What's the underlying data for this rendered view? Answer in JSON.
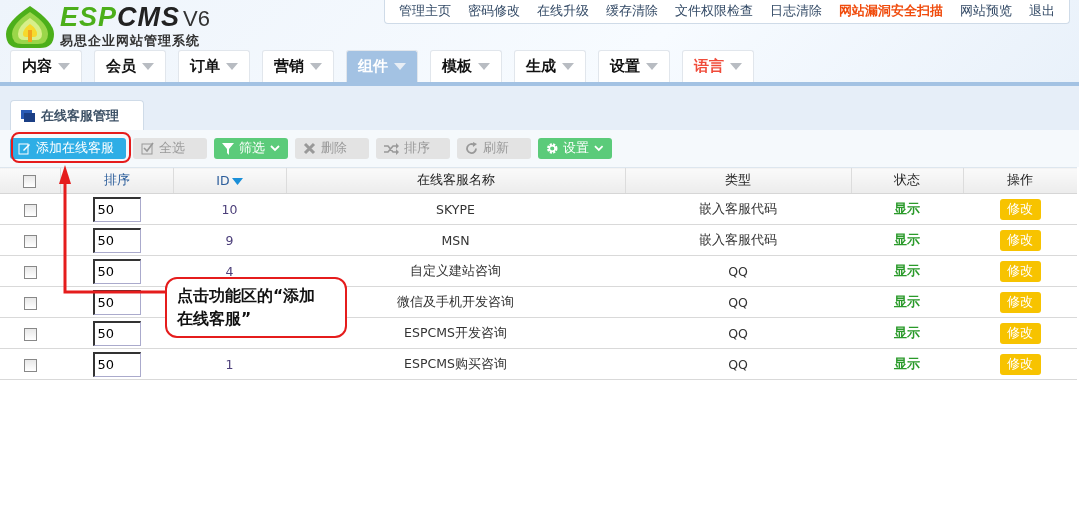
{
  "logo": {
    "brand_a": "ESP",
    "brand_b": "CMS",
    "version": "V6",
    "subtitle": "易思企业网站管理系统"
  },
  "top_links": [
    {
      "label": "管理主页",
      "highlight": false
    },
    {
      "label": "密码修改",
      "highlight": false
    },
    {
      "label": "在线升级",
      "highlight": false
    },
    {
      "label": "缓存清除",
      "highlight": false
    },
    {
      "label": "文件权限检查",
      "highlight": false
    },
    {
      "label": "日志清除",
      "highlight": false
    },
    {
      "label": "网站漏洞安全扫描",
      "highlight": true
    },
    {
      "label": "网站预览",
      "highlight": false
    },
    {
      "label": "退出",
      "highlight": false
    }
  ],
  "nav": [
    {
      "label": "内容",
      "selected": false,
      "highlight": false
    },
    {
      "label": "会员",
      "selected": false,
      "highlight": false
    },
    {
      "label": "订单",
      "selected": false,
      "highlight": false
    },
    {
      "label": "营销",
      "selected": false,
      "highlight": false
    },
    {
      "label": "组件",
      "selected": true,
      "highlight": false
    },
    {
      "label": "模板",
      "selected": false,
      "highlight": false
    },
    {
      "label": "生成",
      "selected": false,
      "highlight": false
    },
    {
      "label": "设置",
      "selected": false,
      "highlight": false
    },
    {
      "label": "语言",
      "selected": false,
      "highlight": true
    }
  ],
  "panel_tab": {
    "label": "在线客服管理"
  },
  "toolbar": [
    {
      "label": "添加在线客服",
      "kind": "primary",
      "dropdown": false
    },
    {
      "label": "全选",
      "kind": "disabled",
      "dropdown": false
    },
    {
      "label": "筛选",
      "kind": "green",
      "dropdown": true
    },
    {
      "label": "删除",
      "kind": "disabled",
      "dropdown": false
    },
    {
      "label": "排序",
      "kind": "disabled",
      "dropdown": false
    },
    {
      "label": "刷新",
      "kind": "disabled",
      "dropdown": false
    },
    {
      "label": "设置",
      "kind": "green",
      "dropdown": true
    }
  ],
  "table": {
    "select_all_checked": false,
    "columns": [
      {
        "label": "排序",
        "sorted": false
      },
      {
        "label": "ID",
        "sorted": true
      },
      {
        "label": "在线客服名称",
        "sorted": false
      },
      {
        "label": "类型",
        "sorted": false
      },
      {
        "label": "状态",
        "sorted": false
      },
      {
        "label": "操作",
        "sorted": false
      }
    ],
    "rows": [
      {
        "checked": false,
        "order": "50",
        "id": "10",
        "name": "SKYPE",
        "type": "嵌入客服代码",
        "status": "显示",
        "action": "修改"
      },
      {
        "checked": false,
        "order": "50",
        "id": "9",
        "name": "MSN",
        "type": "嵌入客服代码",
        "status": "显示",
        "action": "修改"
      },
      {
        "checked": false,
        "order": "50",
        "id": "4",
        "name": "自定义建站咨询",
        "type": "QQ",
        "status": "显示",
        "action": "修改"
      },
      {
        "checked": false,
        "order": "50",
        "name": "微信及手机开发咨询",
        "type": "QQ",
        "status": "显示",
        "action": "修改"
      },
      {
        "checked": false,
        "order": "50",
        "name": "ESPCMS开发咨询",
        "type": "QQ",
        "status": "显示",
        "action": "修改"
      },
      {
        "checked": false,
        "order": "50",
        "id": "1",
        "name": "ESPCMS购买咨询",
        "type": "QQ",
        "status": "显示",
        "action": "修改"
      }
    ]
  },
  "annotation": {
    "callout": "点击功能区的“添加在线客服”"
  }
}
